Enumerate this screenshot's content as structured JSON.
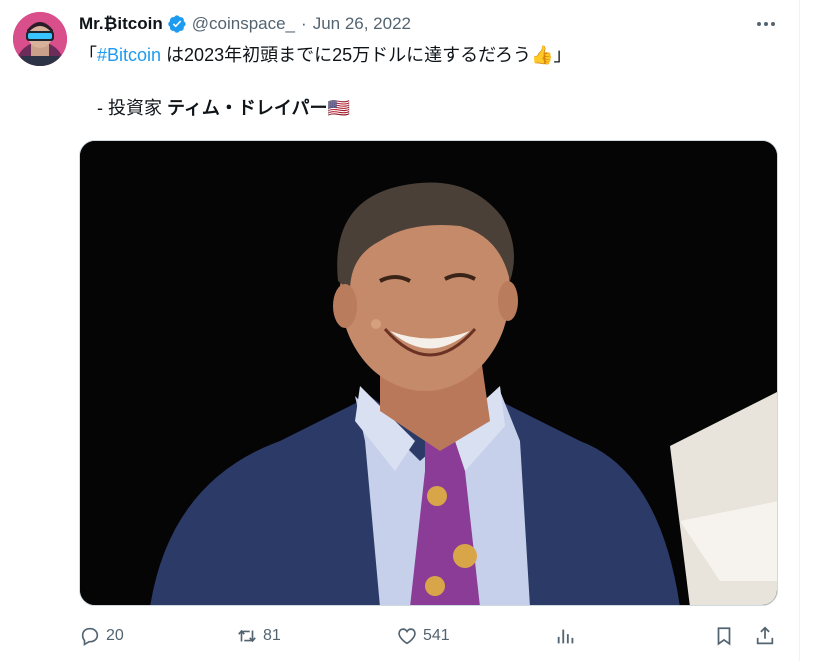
{
  "author": {
    "name": "Mr.₿itcoin",
    "handle": "@coinspace_",
    "separator": "·",
    "date": "Jun 26, 2022"
  },
  "tweet": {
    "open_quote": "「",
    "hashtag": "#Bitcoin",
    "text_after_hashtag": " は2023年初頭までに25万ドルに達するだろう",
    "emoji": "👍",
    "close_quote": "」",
    "attribution_prefix": "- 投資家 ",
    "attribution_name": "ティム・ドレイパー",
    "flag": "🇺🇸"
  },
  "actions": {
    "replies": "20",
    "reposts": "81",
    "likes": "541"
  },
  "colors": {
    "accent": "#1d9bf0",
    "muted": "#536471",
    "text": "#0f1419"
  },
  "icons": [
    "verified-badge-icon",
    "more-icon",
    "reply-icon",
    "repost-icon",
    "like-icon",
    "views-icon",
    "bookmark-icon",
    "share-icon"
  ]
}
